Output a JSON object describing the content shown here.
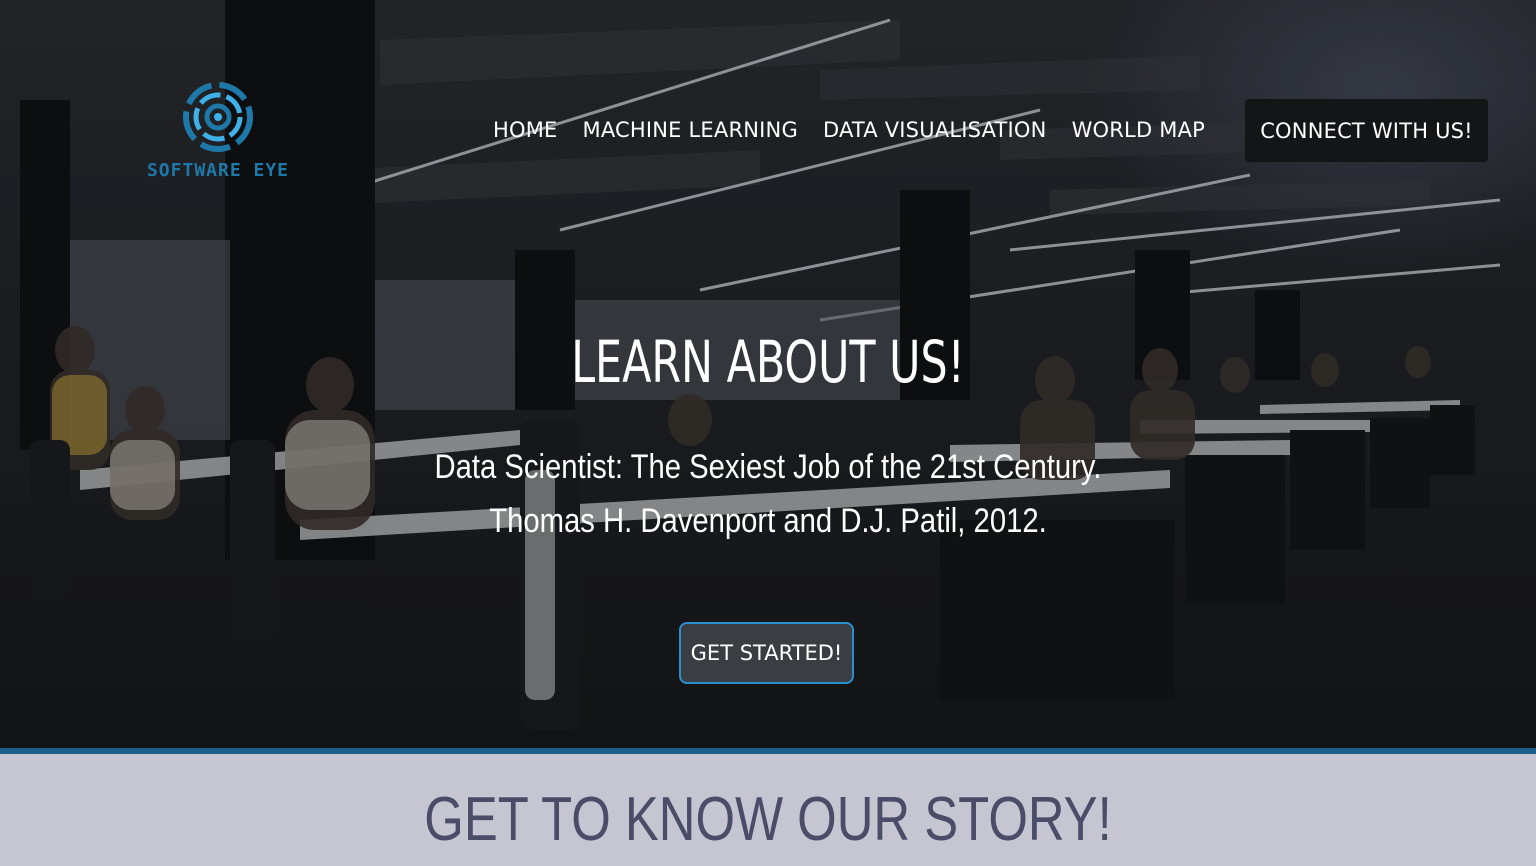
{
  "brand": {
    "logo_text": "SOFTWARE EYE",
    "accent_color": "#1e78a8"
  },
  "nav": {
    "items": [
      {
        "label": "HOME"
      },
      {
        "label": "MACHINE LEARNING"
      },
      {
        "label": "DATA VISUALISATION"
      },
      {
        "label": "WORLD MAP"
      }
    ],
    "cta_label": "CONNECT WITH US!"
  },
  "hero": {
    "title": "LEARN ABOUT US!",
    "quote_line1": "Data Scientist: The Sexiest Job of the 21st Century.",
    "quote_line2": "Thomas H. Davenport and D.J. Patil, 2012.",
    "button_label": "GET STARTED!",
    "button_border_color": "#2a8fcf",
    "bottom_border_color": "#1d5f86"
  },
  "story": {
    "heading": "GET TO KNOW OUR STORY!"
  }
}
